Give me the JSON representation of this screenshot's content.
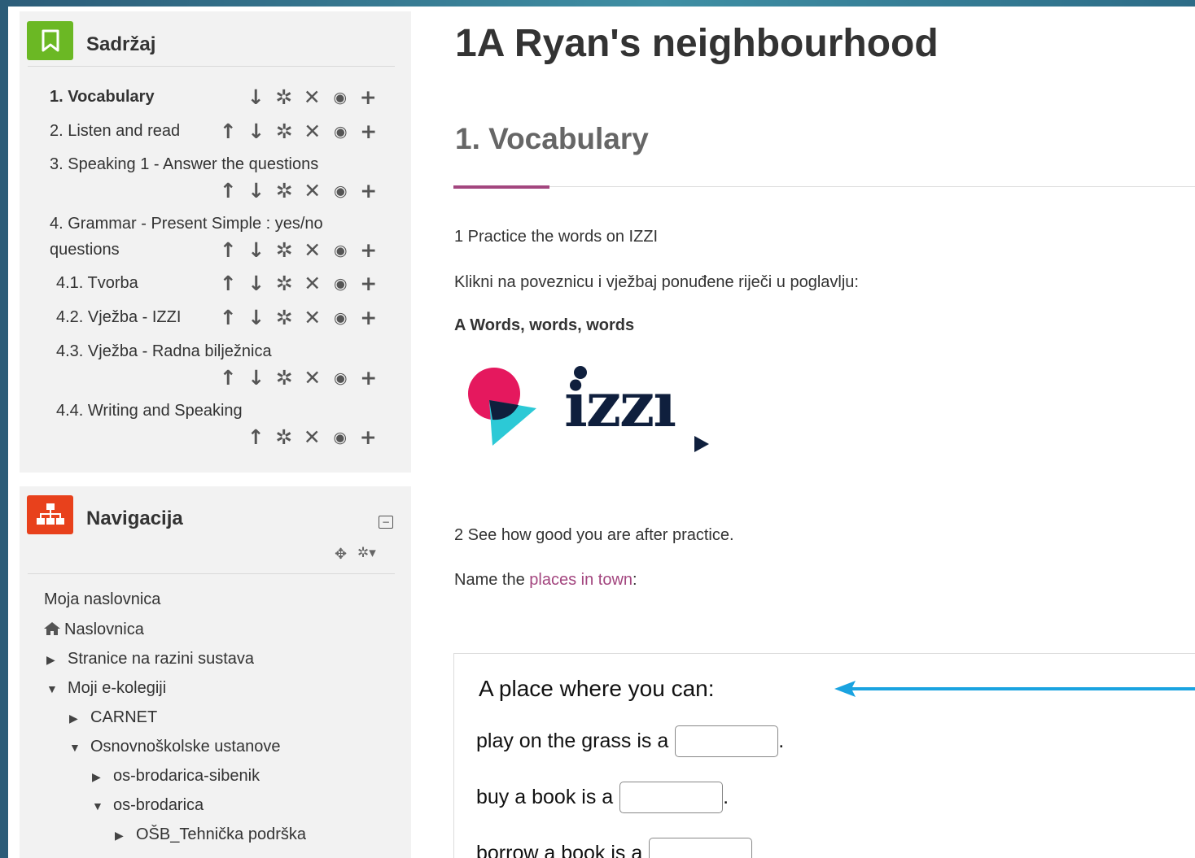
{
  "toc_block": {
    "title": "Sadržaj",
    "icon": "bookmark-icon",
    "items": [
      {
        "label": "1. Vocabulary",
        "active": true
      },
      {
        "label": "2. Listen and read"
      },
      {
        "label": "3. Speaking 1 - Answer the questions"
      },
      {
        "label_line1": "4. Grammar - Present Simple : yes/no",
        "label_line2": "questions"
      },
      {
        "label": "4.1. Tvorba"
      },
      {
        "label": "4.2. Vježba - IZZI"
      },
      {
        "label": "4.3. Vježba - Radna bilježnica"
      },
      {
        "label": "4.4. Writing and Speaking"
      }
    ],
    "action_icons": {
      "up": "↑",
      "down": "↓",
      "gear": "✲",
      "delete": "✕",
      "eye": "◉",
      "add": "+"
    }
  },
  "nav_block": {
    "title": "Navigacija",
    "icon": "sitemap-icon",
    "collapse_glyph": "−",
    "move_glyph": "✥",
    "gear_glyph": "✲▾",
    "items": [
      {
        "label": "Moja naslovnica"
      },
      {
        "label": "Naslovnica",
        "icon": "home-icon",
        "glyph": "⌂"
      },
      {
        "label": "Stranice na razini sustava",
        "glyph": "▶"
      },
      {
        "label": "Moji e-kolegiji",
        "glyph": "▼"
      },
      {
        "label": "CARNET",
        "glyph": "▶"
      },
      {
        "label": "Osnovnoškolske ustanove",
        "glyph": "▼"
      },
      {
        "label": "os-brodarica-sibenik",
        "glyph": "▶"
      },
      {
        "label": "os-brodarica",
        "glyph": "▼"
      },
      {
        "label": "OŠB_Tehnička podrška",
        "glyph": "▶"
      }
    ]
  },
  "main": {
    "page_title": "1A Ryan's neighbourhood",
    "section_title": "1. Vocabulary",
    "para1": "1 Practice the words on IZZI",
    "para2": "Klikni na poveznicu i vježbaj ponuđene riječi u poglavlju:",
    "para3": "A Words, words, words",
    "logo_text": "izzı",
    "para4": "2 See how good you are after practice.",
    "para5_prefix": "Name the ",
    "para5_link": "places in town",
    "para5_suffix": ":",
    "quiz": {
      "heading": "A place where you can:",
      "rows": [
        {
          "prefix": "play on the grass is a",
          "suffix": "."
        },
        {
          "prefix": "buy a book is a",
          "suffix": "."
        },
        {
          "prefix": "borrow a book is a",
          "suffix": ""
        }
      ]
    }
  },
  "colors": {
    "accent_purple": "#a3467f",
    "toc_icon_bg": "#6bb824",
    "nav_icon_bg": "#e8411c",
    "arrow_blue": "#1aa3e0",
    "izzi_navy": "#0f1f3d",
    "izzi_pink": "#e5185e",
    "izzi_cyan": "#2cc9d6"
  }
}
